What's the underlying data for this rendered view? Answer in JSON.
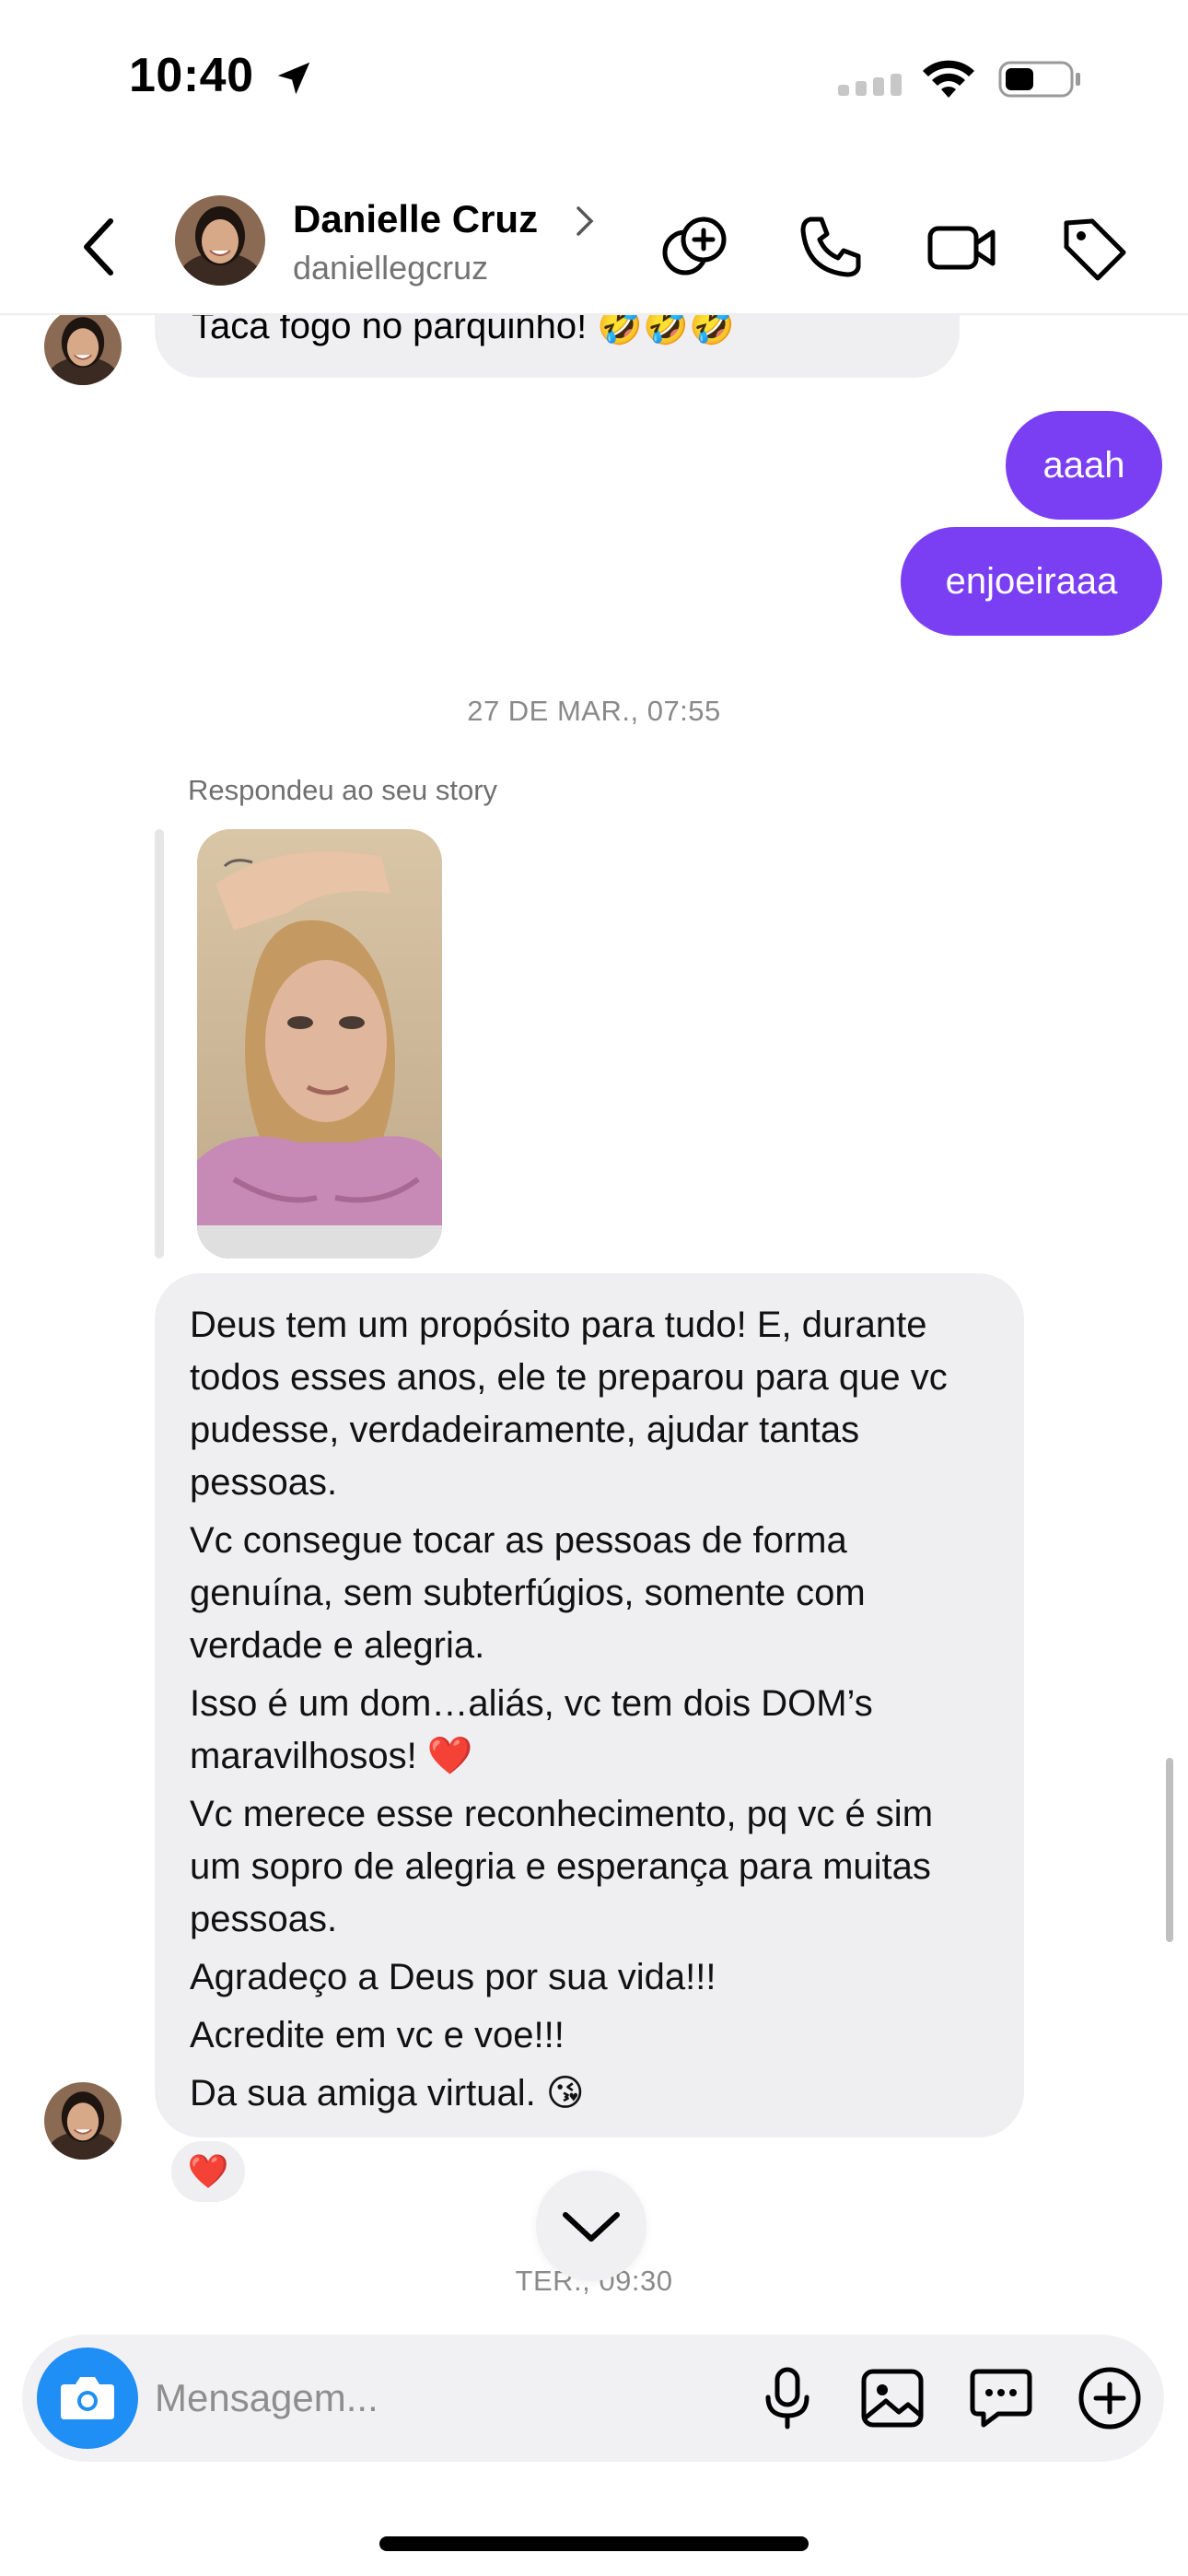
{
  "status_bar": {
    "time": "10:40"
  },
  "header": {
    "name": "Danielle Cruz",
    "username": "daniellegcruz"
  },
  "messages": {
    "previous_incoming": "Taca fogo no parquinho! 🤣🤣🤣",
    "outgoing": [
      "aaah",
      "enjoeiraaa"
    ],
    "timestamp_1": "27 DE MAR., 07:55",
    "reply_label": "Respondeu ao seu story",
    "long_message": [
      "Deus tem um propósito para tudo! E, durante todos esses anos, ele te preparou para que vc pudesse, verdadeiramente, ajudar tantas pessoas.",
      "Vc consegue tocar as pessoas de forma genuína, sem subterfúgios, somente com verdade e alegria.",
      "Isso é um dom…aliás, vc tem dois DOM’s maravilhosos! ❤️",
      "Vc merece esse reconhecimento, pq vc é sim um sopro de alegria e esperança para muitas pessoas.",
      "Agradeço a Deus por sua vida!!!",
      "Acredite em vc e voe!!!",
      "Da sua amiga virtual. 😘"
    ],
    "reaction": "❤️",
    "timestamp_2": "TER., 09:30"
  },
  "composer": {
    "placeholder": "Mensagem..."
  },
  "colors": {
    "outgoing_bubble": "#7a3ff2",
    "incoming_bubble": "#efeff1",
    "camera_button": "#1f8ef5"
  },
  "icons": {
    "header": [
      "chevron-left-icon",
      "avatar",
      "stickers-icon",
      "phone-icon",
      "video-icon",
      "tag-icon"
    ],
    "composer": [
      "camera-icon",
      "microphone-icon",
      "gallery-icon",
      "sticker-chat-icon",
      "plus-icon"
    ]
  }
}
